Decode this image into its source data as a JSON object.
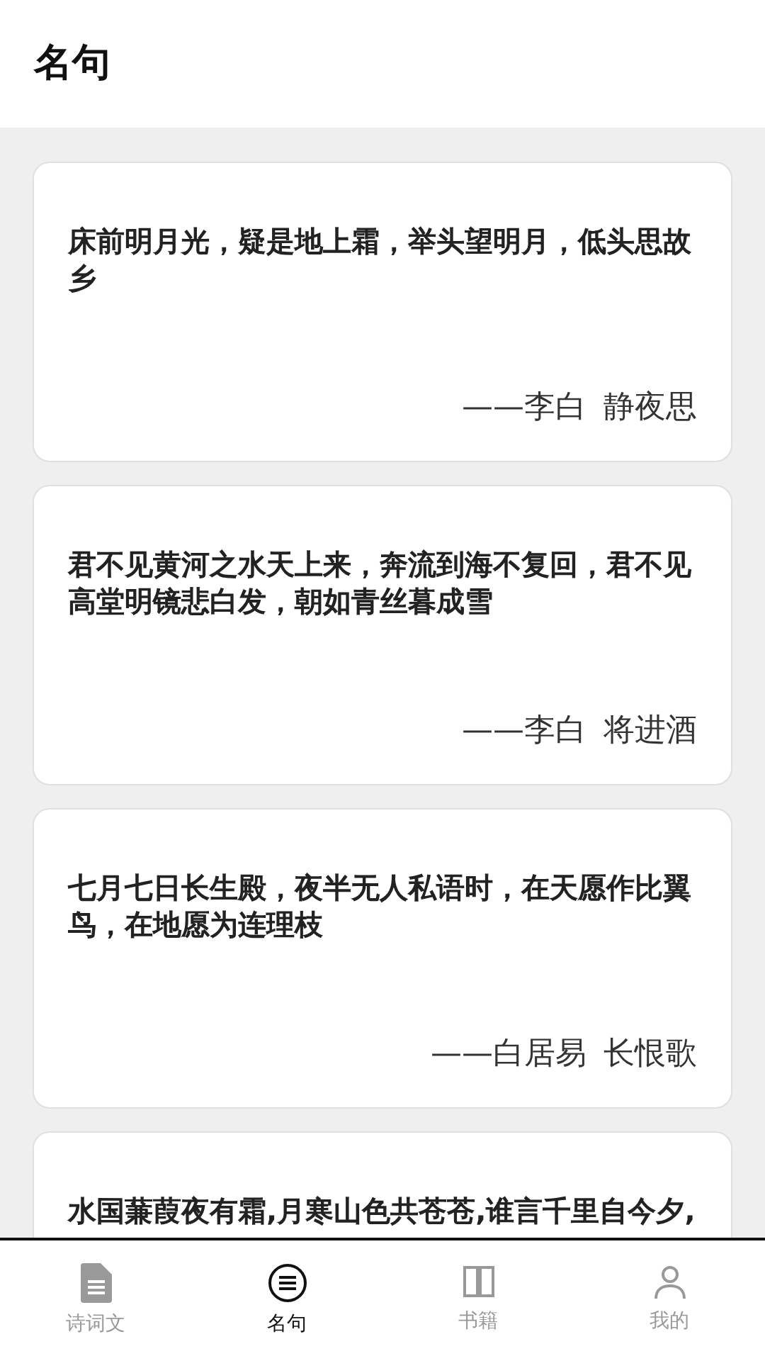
{
  "header": {
    "title": "名句"
  },
  "quotes": [
    {
      "text": "床前明月光，疑是地上霜，举头望明月，低头思故乡",
      "author": "——李白",
      "work": "静夜思"
    },
    {
      "text": "君不见黄河之水天上来，奔流到海不复回，君不见高堂明镜悲白发，朝如青丝暮成雪",
      "author": "——李白",
      "work": "将进酒"
    },
    {
      "text": "七月七日长生殿，夜半无人私语时，在天愿作比翼鸟，在地愿为连理枝",
      "author": "——白居易",
      "work": "长恨歌"
    },
    {
      "text": "水国蒹葭夜有霜,月寒山色共苍苍,谁言千里自今夕,"
    }
  ],
  "tabs": [
    {
      "label": "诗词文",
      "selected": false
    },
    {
      "label": "名句",
      "selected": true
    },
    {
      "label": "书籍",
      "selected": false
    },
    {
      "label": "我的",
      "selected": false
    }
  ]
}
